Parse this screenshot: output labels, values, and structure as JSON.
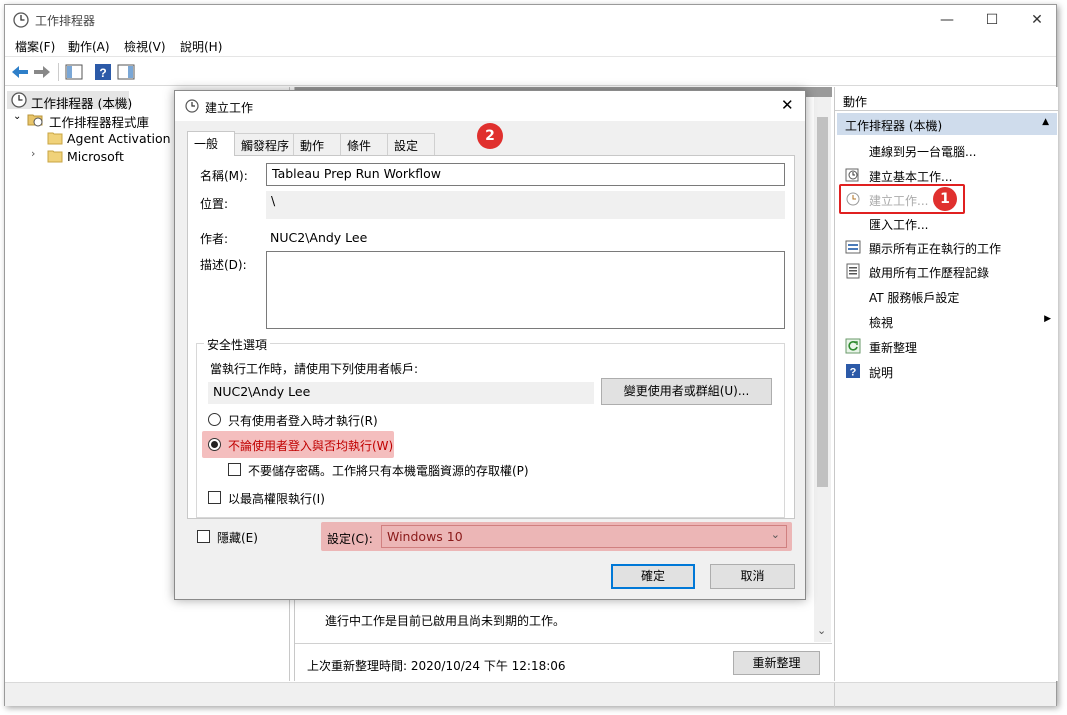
{
  "window": {
    "title": "工作排程器",
    "controls": {
      "minimize": "—",
      "maximize": "☐",
      "close": "✕"
    }
  },
  "menu": [
    "檔案(F)",
    "動作(A)",
    "檢視(V)",
    "說明(H)"
  ],
  "tree": {
    "root": "工作排程器 (本機)",
    "library": "工作排程器程式庫",
    "items": [
      "Agent Activation Ru",
      "Microsoft"
    ]
  },
  "center": {
    "running_text": "進行中工作是目前已啟用且尚未到期的工作。",
    "last_refresh": "上次重新整理時間: 2020/10/24 下午 12:18:06",
    "refresh_button": "重新整理"
  },
  "actions": {
    "header": "動作",
    "section": "工作排程器 (本機)",
    "items": [
      "連線到另一台電腦...",
      "建立基本工作...",
      "建立工作...",
      "匯入工作...",
      "顯示所有正在執行的工作",
      "啟用所有工作歷程記錄",
      "AT 服務帳戶設定",
      "檢視",
      "重新整理",
      "說明"
    ]
  },
  "dialog": {
    "title": "建立工作",
    "close": "✕",
    "tabs": [
      "一般",
      "觸發程序",
      "動作",
      "條件",
      "設定"
    ],
    "name_label": "名稱(M):",
    "name_value": "Tableau Prep Run Workflow",
    "location_label": "位置:",
    "location_value": "\\",
    "author_label": "作者:",
    "author_value": "NUC2\\Andy Lee",
    "description_label": "描述(D):",
    "description_value": "",
    "security": {
      "group_title": "安全性選項",
      "prompt": "當執行工作時，請使用下列使用者帳戶:",
      "account": "NUC2\\Andy Lee",
      "change_button": "變更使用者或群組(U)...",
      "radio_logged_on": "只有使用者登入時才執行(R)",
      "radio_whether": "不論使用者登入與否均執行(W)",
      "no_store_password": "不要儲存密碼。工作將只有本機電腦資源的存取權(P)",
      "highest_privileges": "以最高權限執行(I)"
    },
    "hidden_label": "隱藏(E)",
    "configure_label": "設定(C):",
    "configure_value": "Windows 10",
    "ok_button": "確定",
    "cancel_button": "取消"
  },
  "annotations": {
    "badge1": "1",
    "badge2": "2"
  },
  "colors": {
    "highlight": "#e66e6e",
    "badge": "#e0302e",
    "selected": "#cfdcec",
    "accent": "#0078d7"
  }
}
